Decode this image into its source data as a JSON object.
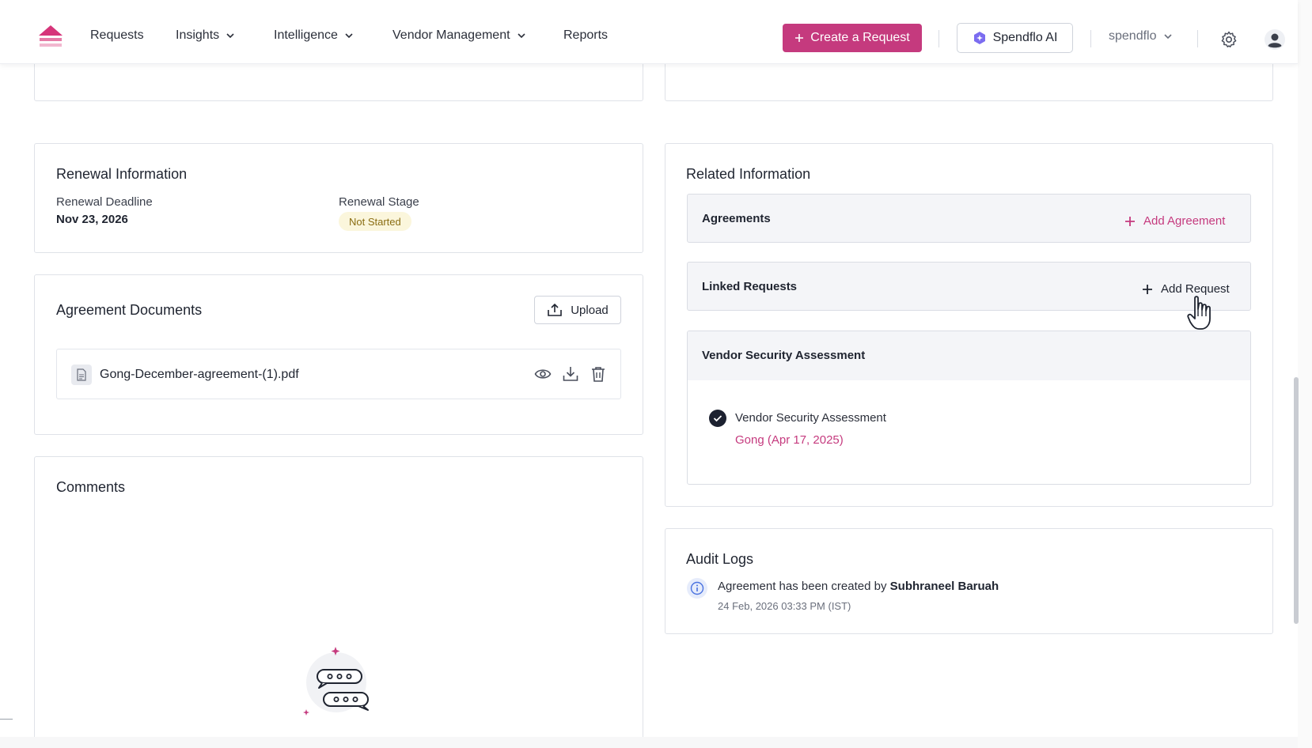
{
  "nav": {
    "items": [
      {
        "label": "Requests"
      },
      {
        "label": "Insights"
      },
      {
        "label": "Intelligence"
      },
      {
        "label": "Vendor Management"
      },
      {
        "label": "Reports"
      }
    ],
    "create_label": "Create a Request",
    "ai_label": "Spendflo AI",
    "org_label": "spendflo"
  },
  "renewal": {
    "title": "Renewal Information",
    "deadline_label": "Renewal Deadline",
    "deadline_value": "Nov 23, 2026",
    "stage_label": "Renewal Stage",
    "stage_value": "Not Started"
  },
  "documents": {
    "title": "Agreement Documents",
    "upload_label": "Upload",
    "file_name": "Gong-December-agreement-(1).pdf"
  },
  "comments": {
    "title": "Comments"
  },
  "related": {
    "title": "Related Information",
    "agreements_label": "Agreements",
    "add_agreement_label": "Add Agreement",
    "linked_requests_label": "Linked Requests",
    "add_request_label": "Add Request",
    "vsa_title": "Vendor Security Assessment",
    "vsa_item_title": "Vendor Security Assessment",
    "vsa_item_link": "Gong (Apr 17, 2025)"
  },
  "audit": {
    "title": "Audit Logs",
    "entry_text": "Agreement has been created by",
    "entry_user": "Subhraneel Baruah",
    "entry_time": "24 Feb, 2026 03:33 PM (IST)"
  },
  "colors": {
    "accent": "#c53a7e",
    "badge_bg": "#fbf6dc",
    "badge_text": "#8a6d12"
  }
}
